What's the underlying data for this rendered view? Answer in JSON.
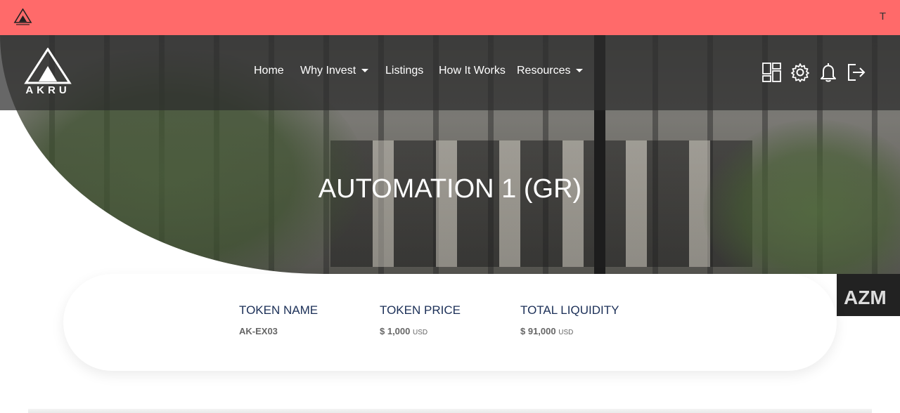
{
  "topbar": {
    "avatar_initial": "T",
    "background": "#ff6a6a"
  },
  "brand": {
    "name": "AKRU"
  },
  "nav": {
    "items": [
      {
        "label": "Home",
        "has_dropdown": false
      },
      {
        "label": "Why Invest",
        "has_dropdown": true
      },
      {
        "label": "Listings",
        "has_dropdown": false
      },
      {
        "label": "How It Works",
        "has_dropdown": false
      },
      {
        "label": "Resources",
        "has_dropdown": true
      }
    ],
    "icons": [
      "dashboard-icon",
      "gear-icon",
      "bell-icon",
      "logout-icon"
    ]
  },
  "hero": {
    "title": "AUTOMATION 1 (GR)"
  },
  "stats": [
    {
      "label": "TOKEN NAME",
      "value": "AK-EX03",
      "unit": ""
    },
    {
      "label": "TOKEN PRICE",
      "value": "$ 1,000",
      "unit": "USD"
    },
    {
      "label": "TOTAL LIQUIDITY",
      "value": "$ 91,000",
      "unit": "USD"
    }
  ],
  "background_sign": "AZM",
  "colors": {
    "accent_text": "#1b2f57",
    "value_text": "#666666"
  }
}
